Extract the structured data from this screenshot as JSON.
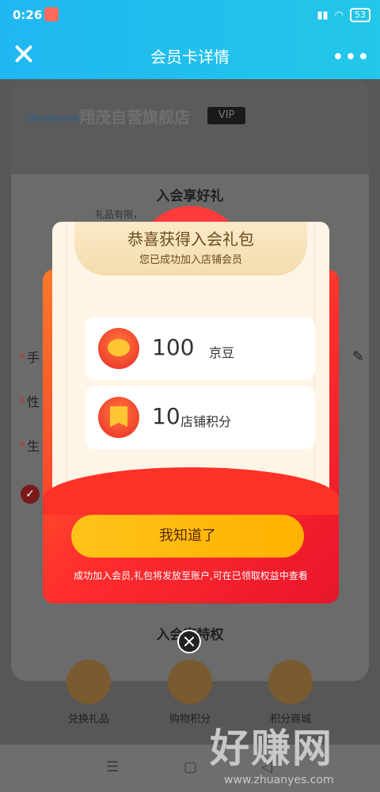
{
  "status": {
    "time": "0:26",
    "battery": "53"
  },
  "header": {
    "title": "会员卡详情",
    "more": "•••"
  },
  "background": {
    "store_logo": "JBoommot",
    "store_name": "翔茂自营旗舰店",
    "vip_badge": "VIP",
    "gift_title": "入会享好礼",
    "gift_sub": "礼品有限，",
    "fields": [
      "手",
      "性",
      "生"
    ],
    "privileges_title": "入会享特权",
    "privileges": [
      "兑换礼品",
      "购物积分",
      "积分商城"
    ]
  },
  "modal": {
    "title": "恭喜获得入会礼包",
    "subtitle": "您已成功加入店铺会员",
    "rewards": [
      {
        "icon": "bean-coin-icon",
        "value": "100",
        "unit": "京豆"
      },
      {
        "icon": "points-flag-icon",
        "value": "10",
        "unit": "店铺积分"
      }
    ],
    "button": "我知道了",
    "note": "成功加入会员,礼包将发放至账户,可在已领取权益中查看"
  },
  "sysnav": {
    "menu": "☰",
    "home": "▢",
    "back": "◁"
  },
  "watermark": {
    "text": "好赚网",
    "url": "www.zhuanyes.com"
  }
}
